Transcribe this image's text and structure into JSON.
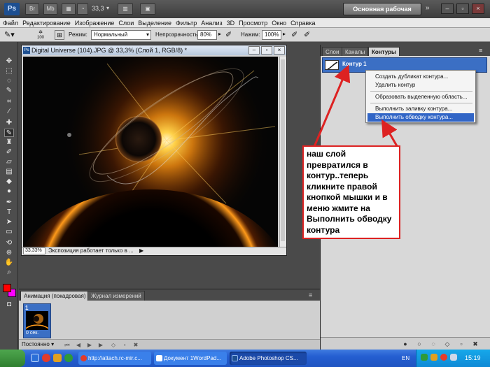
{
  "appbar": {
    "logo": "Ps",
    "zoom": "33,3",
    "zoom_arrow": "▾",
    "workspace": "Основная рабочая среда",
    "more": "»"
  },
  "menu": [
    "Файл",
    "Редактирование",
    "Изображение",
    "Слои",
    "Выделение",
    "Фильтр",
    "Анализ",
    "3D",
    "Просмотр",
    "Окно",
    "Справка"
  ],
  "options": {
    "brush_size": "100",
    "mode_label": "Режим:",
    "mode_value": "Нормальный",
    "opacity_label": "Непрозрачность:",
    "opacity_value": "80%",
    "pressure_label": "Нажим:",
    "pressure_value": "100%"
  },
  "document": {
    "title": "Digital Universe (104).JPG @ 33,3% (Слой 1, RGB/8) *",
    "zoom": "33,33%",
    "status": "Экспозиция работает только в ...",
    "icon_text": "Ps"
  },
  "panel": {
    "tabs": [
      "Слои",
      "Каналы",
      "Контуры"
    ],
    "path_name": "Контур 1",
    "menu_icon": "≡"
  },
  "context_menu": {
    "items": [
      "Создать дубликат контура...",
      "Удалить контур",
      "Образовать выделенную область...",
      "Выполнить заливку контура...",
      "Выполнить обводку контура..."
    ],
    "selected_index": 4
  },
  "annotation": {
    "text": "наш слой превратился в контур..теперь кликните правой кнопкой мышки и в меню жмите на Выполнить обводку контура",
    "border_color": "#dd2222"
  },
  "animation": {
    "tabs": [
      "Анимация (покадровая)",
      "Журнал измерений"
    ],
    "frame_number": "1",
    "frame_delay": "0 сек.",
    "loop": "Постоянно"
  },
  "taskbar": {
    "tasks": [
      "http://attach.rc-mir.c...",
      "Документ 1WordPad...",
      "Adobe Photoshop CS..."
    ],
    "lang": "EN",
    "clock": "15:19"
  },
  "colors": {
    "accent": "#3165c6",
    "path_row": "#3b6fc4",
    "foreground": "#ff0000",
    "background": "#ff00ff"
  }
}
